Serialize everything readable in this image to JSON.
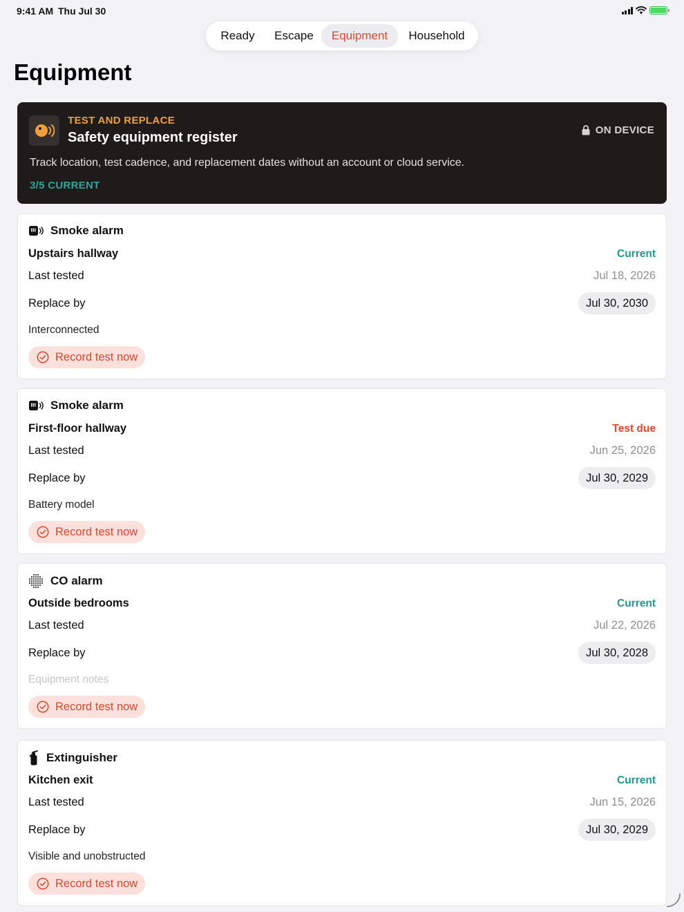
{
  "status_bar": {
    "time": "9:41 AM",
    "date": "Thu Jul 30",
    "icons": [
      "cellular-signal-icon",
      "wifi-icon",
      "battery-charging-icon"
    ]
  },
  "tabs": [
    {
      "label": "Ready",
      "active": false
    },
    {
      "label": "Escape",
      "active": false
    },
    {
      "label": "Equipment",
      "active": true
    },
    {
      "label": "Household",
      "active": false
    }
  ],
  "page": {
    "title": "Equipment"
  },
  "hero": {
    "eyebrow": "TEST AND REPLACE",
    "title": "Safety equipment register",
    "description": "Track location, test cadence, and replacement dates without an account or cloud service.",
    "count": "3/5 CURRENT",
    "badge": "ON DEVICE",
    "icon": "alarm-sound-icon"
  },
  "labels": {
    "last_tested": "Last tested",
    "replace_by": "Replace by",
    "record_button": "Record test now"
  },
  "colors": {
    "accent": "#e0452f",
    "current": "#1f9a8e",
    "hero_bg": "#1f1b1b",
    "hero_eyebrow": "#f0a03a"
  },
  "equipment": [
    {
      "type": "Smoke alarm",
      "icon": "smoke-alarm-icon",
      "location": "Upstairs hallway",
      "status": "Current",
      "status_kind": "current",
      "last_tested": "Jul 18, 2026",
      "replace_by": "Jul 30, 2030",
      "note": "Interconnected",
      "note_placeholder": false
    },
    {
      "type": "Smoke alarm",
      "icon": "smoke-alarm-icon",
      "location": "First-floor hallway",
      "status": "Test due",
      "status_kind": "due",
      "last_tested": "Jun 25, 2026",
      "replace_by": "Jul 30, 2029",
      "note": "Battery model",
      "note_placeholder": false
    },
    {
      "type": "CO alarm",
      "icon": "co-alarm-icon",
      "location": "Outside bedrooms",
      "status": "Current",
      "status_kind": "current",
      "last_tested": "Jul 22, 2026",
      "replace_by": "Jul 30, 2028",
      "note": "Equipment notes",
      "note_placeholder": true
    },
    {
      "type": "Extinguisher",
      "icon": "fire-extinguisher-icon",
      "location": "Kitchen exit",
      "status": "Current",
      "status_kind": "current",
      "last_tested": "Jun 15, 2026",
      "replace_by": "Jul 30, 2029",
      "note": "Visible and unobstructed",
      "note_placeholder": false
    }
  ]
}
